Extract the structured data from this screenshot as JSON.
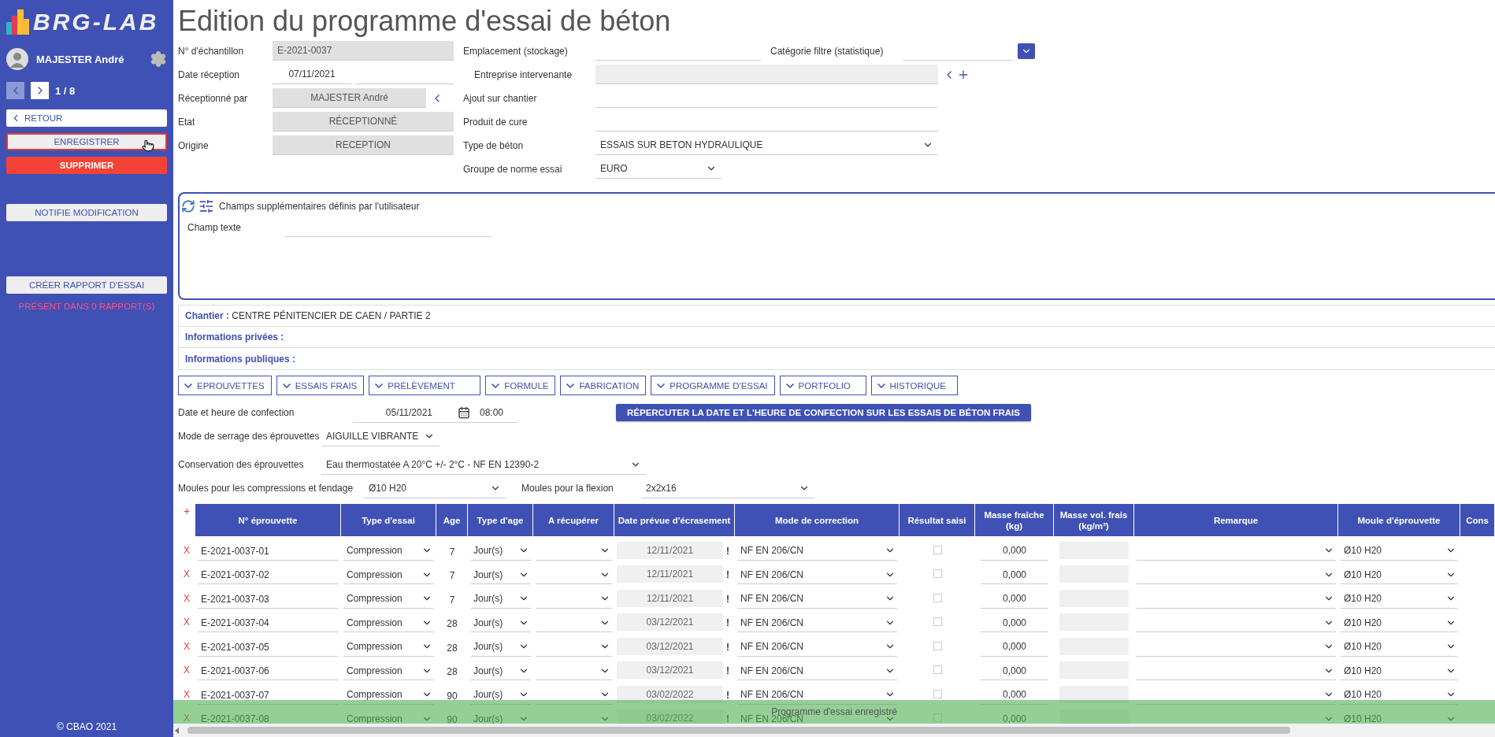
{
  "sidebar": {
    "logo": "BRG-LAB",
    "user": "MAJESTER André",
    "pager": {
      "prev_disabled": true,
      "next_disabled": false,
      "position": "1 / 8"
    },
    "button_groups": [
      [
        {
          "label": "RETOUR",
          "kind": "back",
          "focused": false
        },
        {
          "label": "ENREGISTRER",
          "kind": "plain",
          "focused": true
        },
        {
          "label": "SUPPRIMER",
          "kind": "danger",
          "focused": false
        }
      ],
      [
        {
          "label": "NOTIFIE MODIFICATION",
          "kind": "plain",
          "focused": false
        }
      ],
      [
        {
          "label": "CRÉER RAPPORT D'ESSAI",
          "kind": "plain",
          "focused": false
        }
      ]
    ],
    "report_note": "PRÉSENT DANS 0 RAPPORT(S)",
    "footer": "© CBAO 2021"
  },
  "title": "Edition du programme d'essai de béton",
  "sample_fields": [
    {
      "label": "N° d'échantillon",
      "kind": "id",
      "value": "E-2021-0037"
    },
    {
      "label": "Date réception",
      "kind": "date",
      "value": "07/11/2021"
    },
    {
      "label": "Réceptionné par",
      "kind": "link",
      "value": "MAJESTER André"
    },
    {
      "label": "Etat",
      "kind": "readonly",
      "value": "RÉCEPTIONNÉ"
    },
    {
      "label": "Origine",
      "kind": "readonly",
      "value": "RECEPTION"
    }
  ],
  "site_fields": [
    {
      "label": "Emplacement (stockage)",
      "kind": "category",
      "category_label": "Catégorie filtre (statistique)"
    },
    {
      "label": "Entreprise intervenante",
      "kind": "lookup"
    },
    {
      "label": "Ajout sur chantier",
      "kind": "text"
    },
    {
      "label": "Produit de cure",
      "kind": "text"
    },
    {
      "label": "Type de béton",
      "kind": "select",
      "value": "ESSAIS SUR BETON HYDRAULIQUE"
    },
    {
      "label": "Groupe de norme essai",
      "kind": "short-select",
      "value": "EURO"
    }
  ],
  "custom_fields": {
    "title": "Champs supplémentaires définis par l'utilisateur",
    "fields": [
      {
        "label": "Champ texte"
      }
    ]
  },
  "info": [
    {
      "label": "Chantier :",
      "value": "CENTRE PÉNITENCIER DE CAEN / PARTIE 2"
    },
    {
      "label": "Informations privées :"
    },
    {
      "label": "Informations publiques :"
    }
  ],
  "section_tabs": [
    "EPROUVETTES",
    "ESSAIS FRAIS",
    "PRÉLÈVEMENT",
    "FORMULE",
    "FABRICATION",
    "PROGRAMME D'ESSAI",
    "PORTFOLIO",
    "HISTORIQUE"
  ],
  "confection": {
    "label": "Date et heure de confection",
    "date": "05/11/2021",
    "time": "08:00",
    "button": "RÉPERCUTER LA DATE ET L'HEURE DE CONFECTION SUR LES ESSAIS DE BÉTON FRAIS"
  },
  "serrage": {
    "label": "Mode de serrage des éprouvettes",
    "value": "AIGUILLE VIBRANTE"
  },
  "conservation": {
    "label": "Conservation des éprouvettes",
    "value": "Eau thermostatée A 20°C +/- 2°C - NF EN 12390-2"
  },
  "moulds": [
    {
      "label": "Moules pour les compressions et fendage",
      "value": "Ø10 H20"
    },
    {
      "label": "Moules pour la flexion",
      "value": "2x2x16"
    }
  ],
  "table": {
    "add": "+",
    "columns": [
      "N° éprouvette",
      "Type d'essai",
      "Age",
      "Type d'age",
      "A récupérer",
      "Date prévue d'écrasement",
      "Mode de correction",
      "Résultat saisi",
      "Masse fraîche (kg)",
      "Masse vol. frais (kg/m³)",
      "Remarque",
      "Moule d'éprouvette",
      "Cons"
    ],
    "rows": [
      {
        "delete": "X",
        "id": "E-2021-0037-01",
        "type": "Compression",
        "age": "7",
        "age_unit": "Jour(s)",
        "date": "12/11/2021",
        "warning": "!",
        "mode": "NF EN 206/CN",
        "checked": false,
        "mass": "0,000",
        "mould": "Ø10 H20"
      },
      {
        "delete": "X",
        "id": "E-2021-0037-02",
        "type": "Compression",
        "age": "7",
        "age_unit": "Jour(s)",
        "date": "12/11/2021",
        "warning": "!",
        "mode": "NF EN 206/CN",
        "checked": false,
        "mass": "0,000",
        "mould": "Ø10 H20"
      },
      {
        "delete": "X",
        "id": "E-2021-0037-03",
        "type": "Compression",
        "age": "7",
        "age_unit": "Jour(s)",
        "date": "12/11/2021",
        "warning": "!",
        "mode": "NF EN 206/CN",
        "checked": false,
        "mass": "0,000",
        "mould": "Ø10 H20"
      },
      {
        "delete": "X",
        "id": "E-2021-0037-04",
        "type": "Compression",
        "age": "28",
        "age_unit": "Jour(s)",
        "date": "03/12/2021",
        "warning": "!",
        "mode": "NF EN 206/CN",
        "checked": false,
        "mass": "0,000",
        "mould": "Ø10 H20"
      },
      {
        "delete": "X",
        "id": "E-2021-0037-05",
        "type": "Compression",
        "age": "28",
        "age_unit": "Jour(s)",
        "date": "03/12/2021",
        "warning": "!",
        "mode": "NF EN 206/CN",
        "checked": false,
        "mass": "0,000",
        "mould": "Ø10 H20"
      },
      {
        "delete": "X",
        "id": "E-2021-0037-06",
        "type": "Compression",
        "age": "28",
        "age_unit": "Jour(s)",
        "date": "03/12/2021",
        "warning": "!",
        "mode": "NF EN 206/CN",
        "checked": false,
        "mass": "0,000",
        "mould": "Ø10 H20"
      },
      {
        "delete": "X",
        "id": "E-2021-0037-07",
        "type": "Compression",
        "age": "90",
        "age_unit": "Jour(s)",
        "date": "03/02/2022",
        "warning": "!",
        "mode": "NF EN 206/CN",
        "checked": false,
        "mass": "0,000",
        "mould": "Ø10 H20"
      },
      {
        "delete": "X",
        "id": "E-2021-0037-08",
        "type": "Compression",
        "age": "90",
        "age_unit": "Jour(s)",
        "date": "03/02/2022",
        "warning": "!",
        "mode": "NF EN 206/CN",
        "checked": false,
        "mass": "0,000",
        "mould": "Ø10 H20"
      }
    ]
  },
  "toast": "Programme d'essai enregistré"
}
